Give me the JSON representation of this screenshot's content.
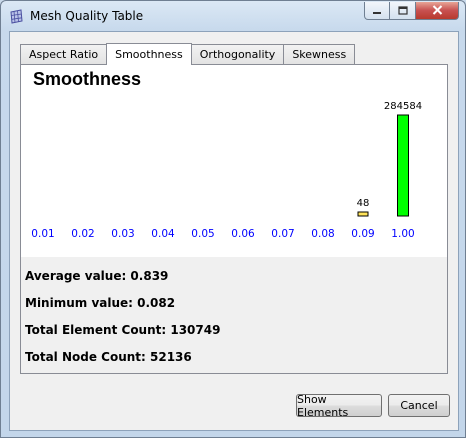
{
  "window": {
    "title": "Mesh Quality Table",
    "icon": "mesh-grid-icon",
    "controls": [
      "minimize-icon",
      "maximize-icon",
      "close-icon"
    ]
  },
  "tabs": [
    {
      "label": "Aspect Ratio",
      "active": false
    },
    {
      "label": "Smoothness",
      "active": true
    },
    {
      "label": "Orthogonality",
      "active": false
    },
    {
      "label": "Skewness",
      "active": false
    }
  ],
  "chart_data": {
    "type": "bar",
    "title": "Smoothness",
    "categories": [
      "0.01",
      "0.02",
      "0.03",
      "0.04",
      "0.05",
      "0.06",
      "0.07",
      "0.08",
      "0.09",
      "1.00"
    ],
    "values": [
      0,
      0,
      0,
      0,
      0,
      0,
      0,
      0,
      48,
      284584
    ],
    "data_labels": [
      "",
      "",
      "",
      "",
      "",
      "",
      "",
      "",
      "48",
      "284584"
    ],
    "bar_colors": [
      "#ffff00",
      "#ffff00",
      "#ffff00",
      "#ffff00",
      "#ffff00",
      "#ffff00",
      "#ffff00",
      "#ffff00",
      "#ffe35a",
      "#00ff00"
    ],
    "tick_label_color": "#0000ff",
    "grid": false,
    "legend": "none"
  },
  "stats": {
    "average": "Average value: 0.839",
    "minimum": "Minimum value: 0.082",
    "element_count": "Total Element Count: 130749",
    "node_count": "Total Node Count: 52136"
  },
  "buttons": {
    "show_elements": "Show Elements",
    "cancel": "Cancel"
  }
}
